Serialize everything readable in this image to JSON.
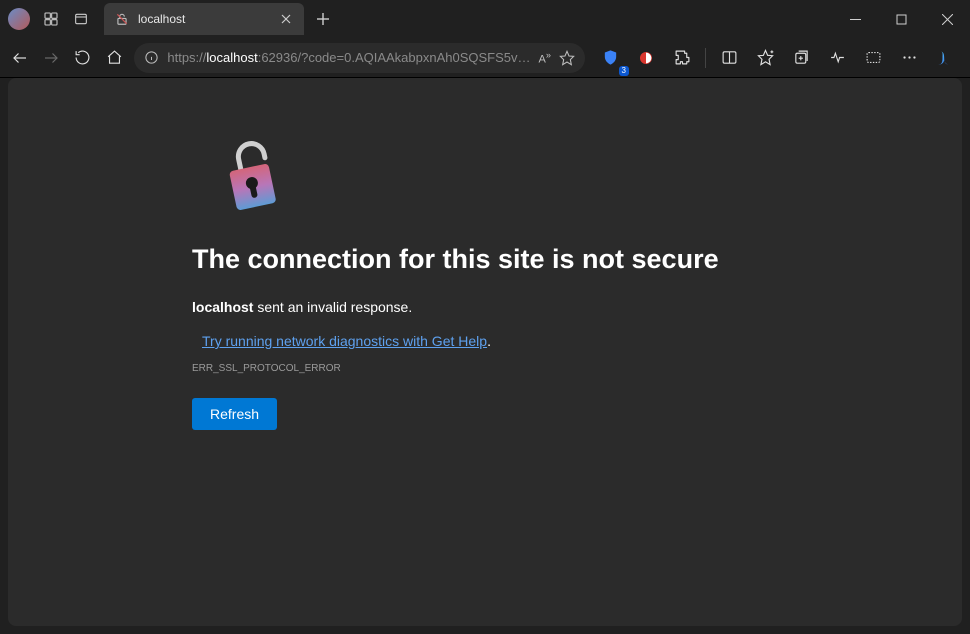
{
  "tab": {
    "title": "localhost"
  },
  "address": {
    "protocol": "https://",
    "host": "localhost",
    "rest": ":62936/?code=0.AQIAAkabpxnAh0SQSFS5v…"
  },
  "ext_badge": "3",
  "error": {
    "heading": "The connection for this site is not secure",
    "host": "localhost",
    "message_rest": " sent an invalid response.",
    "diag_link": "Try running network diagnostics with Get Help",
    "diag_period": ".",
    "code": "ERR_SSL_PROTOCOL_ERROR",
    "refresh_label": "Refresh"
  }
}
